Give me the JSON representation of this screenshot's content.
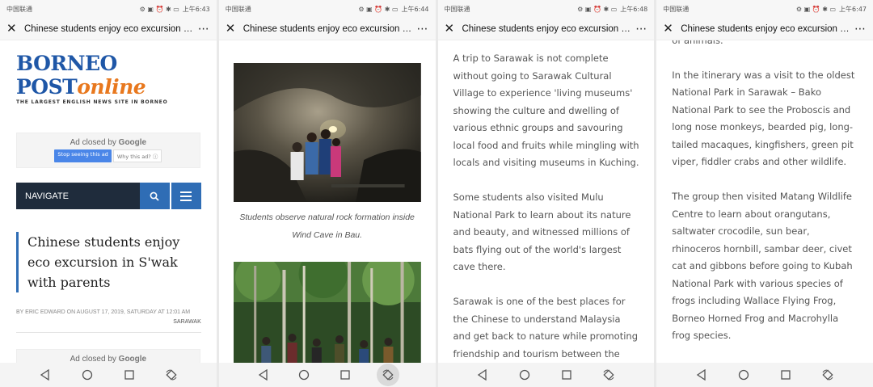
{
  "screens": [
    {
      "status": {
        "carrier": "中国联通",
        "time": "上午6:43"
      },
      "title": "Chinese students enjoy eco excursion i..."
    },
    {
      "status": {
        "carrier": "中国联通",
        "time": "上午6:44"
      },
      "title": "Chinese students enjoy eco excursion i..."
    },
    {
      "status": {
        "carrier": "中国联通",
        "time": "上午6:48"
      },
      "title": "Chinese students enjoy eco excursion i..."
    },
    {
      "status": {
        "carrier": "中国联通",
        "time": "上午6:47"
      },
      "title": "Chinese students enjoy eco excursion i..."
    }
  ],
  "logo": {
    "main": "BORNEO POST",
    "online": "online",
    "tagline": "THE LARGEST ENGLISH NEWS SITE IN BORNEO"
  },
  "ad": {
    "closed_prefix": "Ad closed by ",
    "brand": "Google",
    "stop": "Stop seeing this ad",
    "why": "Why this ad? ⓘ"
  },
  "navigate": {
    "label": "NAVIGATE"
  },
  "article": {
    "headline": "Chinese students enjoy eco excursion in S'wak with parents",
    "byline": "BY ERIC EDWARD ON AUGUST 17, 2019, SATURDAY AT 12:01 AM",
    "category": "SARAWAK",
    "caption": "Students observe natural rock formation inside Wind Cave in Bau.",
    "p_s3": [
      "A trip to Sarawak is not complete without going to Sarawak Cultural Village to experience 'living museums' showing the culture and dwelling of various ethnic groups and savouring local food and fruits while mingling with locals and visiting museums in Kuching.",
      "Some students also visited Mulu National Park to learn about its nature and beauty, and witnessed millions of bats flying out of the world's largest cave there.",
      "Sarawak is one of the best places for the Chinese to understand Malaysia and get back to nature while promoting friendship and tourism between the"
    ],
    "p_s4_clipped": "of animals.",
    "p_s4": [
      "In the itinerary was a visit to the oldest National Park in Sarawak – Bako National Park to see the Proboscis and long nose monkeys, bearded pig, long-tailed macaques, kingfishers, green pit viper, fiddler crabs and other wildlife.",
      "The group then visited Matang Wildlife Centre to learn about orangutans, saltwater crocodile, sun bear, rhinoceros hornbill, sambar deer, civet cat and gibbons before going to Kubah National Park with various species of frogs including Wallace Flying Frog, Borneo Horned Frog and Macrohylla frog species."
    ]
  }
}
